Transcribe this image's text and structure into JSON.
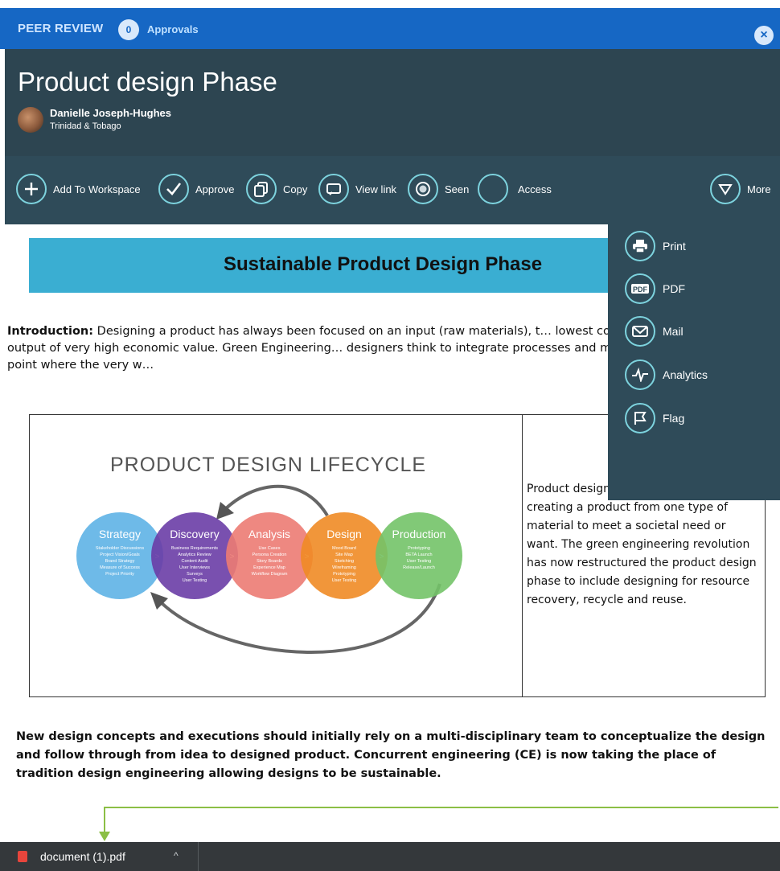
{
  "topbar": {
    "title": "PEER REVIEW",
    "count": "0",
    "approvals": "Approvals",
    "close": "×"
  },
  "header": {
    "title": "Product design Phase",
    "author": "Danielle Joseph-Hughes",
    "country": "Trinidad & Tobago"
  },
  "toolbar": {
    "add": "Add To Workspace",
    "approve": "Approve",
    "copy": "Copy",
    "view_link": "View link",
    "seen": "Seen",
    "access": "Access",
    "more": "More"
  },
  "more_menu": {
    "print": "Print",
    "pdf": "PDF",
    "mail": "Mail",
    "analytics": "Analytics",
    "flag": "Flag"
  },
  "document": {
    "banner_title": "Sustainable Product Design Phase",
    "intro_label": "Introduction:",
    "intro_text": "Designing a product has always been focused on an input (raw materials), t… lowest cost of production to give an output of very high economic value. Green Engineering… designers think to integrate processes and maximize resources to a point where the very w…",
    "lifecycle_title": "PRODUCT DESIGN LIFECYCLE",
    "stages": [
      {
        "name": "Strategy",
        "color": "#5eb3e6",
        "items": [
          "Stakeholder Discussions",
          "Project Vision/Goals",
          "Brand Strategy",
          "Measure of Success",
          "Project Priority"
        ]
      },
      {
        "name": "Discovery",
        "color": "#6a3da6",
        "items": [
          "Business Requirements",
          "Analytics Review",
          "Content Audit",
          "User Interviews",
          "Surveys",
          "User Testing"
        ]
      },
      {
        "name": "Analysis",
        "color": "#ec7b73",
        "items": [
          "Use Cases",
          "Persona Creation",
          "Story Boards",
          "Experience Map",
          "Workflow Diagram"
        ]
      },
      {
        "name": "Design",
        "color": "#ef8b25",
        "items": [
          "Mood Board",
          "Site Map",
          "Sketching",
          "Wireframing",
          "Prototyping",
          "User Testing"
        ]
      },
      {
        "name": "Production",
        "color": "#73c368",
        "items": [
          "Prototyping",
          "BETA Launch",
          "User Testing",
          "Release/Launch"
        ]
      }
    ],
    "side_text": "Product design… limited to focusing creating a product from one type of material to meet a societal need or want. The green engineering revolution has now restructured the product design phase to include designing for resource recovery, recycle and reuse.",
    "bottom_text": "New design concepts and executions should initially rely on a multi-disciplinary team to conceptualize the design and follow through from idea to designed product. Concurrent engineering (CE) is now taking the place of tradition design engineering allowing designs to be sustainable."
  },
  "download_bar": {
    "filename": "document (1).pdf",
    "caret": "^"
  },
  "colors": {
    "topbar": "#1667c4",
    "header": "#2d4551",
    "toolbar": "#2f4b59",
    "accent": "#7dd3de",
    "banner": "#3aaed2",
    "annotation": "#8bbf45"
  }
}
